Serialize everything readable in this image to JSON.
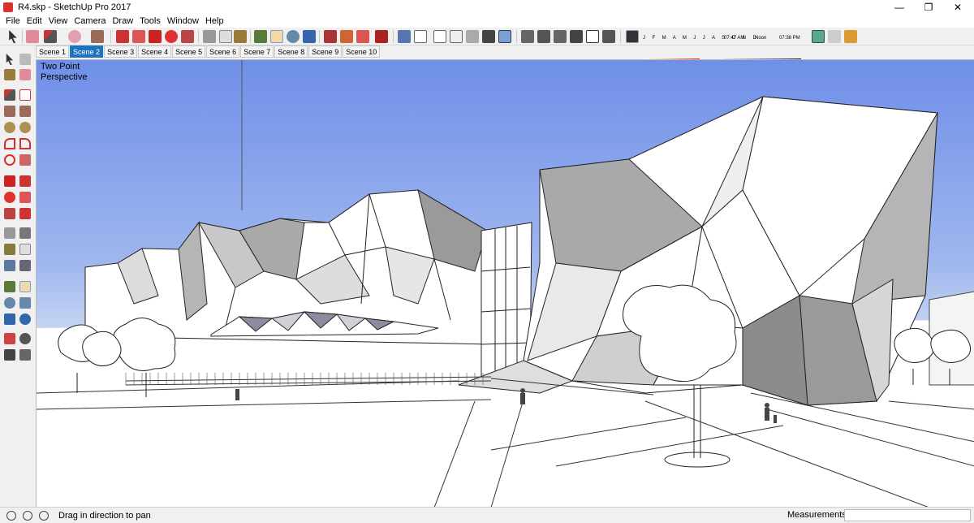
{
  "window": {
    "title": "R4.skp - SketchUp Pro 2017",
    "minimize": "—",
    "maximize": "❐",
    "close": "✕"
  },
  "menu": [
    "File",
    "Edit",
    "View",
    "Camera",
    "Draw",
    "Tools",
    "Window",
    "Help"
  ],
  "shadow_settings": {
    "months": "J F M A M J J A S O N D",
    "time_start": "07:47 AM",
    "time_mid": "Noon",
    "time_end": "07:38 PM"
  },
  "scenes": [
    "Scene 1",
    "Scene 2",
    "Scene 3",
    "Scene 4",
    "Scene 5",
    "Scene 6",
    "Scene 7",
    "Scene 8",
    "Scene 9",
    "Scene 10"
  ],
  "active_scene": "Scene 2",
  "viewport": {
    "camera_label_line1": "Two Point",
    "camera_label_line2": "Perspective"
  },
  "status": {
    "hint": "Drag in direction to pan",
    "measurements_label": "Measurements",
    "measurements_value": ""
  },
  "colors": {
    "sky_top": "#6f8fe8",
    "sky_bottom": "#dfe8f6",
    "ground": "#ffffff",
    "active_tab": "#1e73be",
    "building_light": "#ffffff",
    "building_shade": "#a9a9a9",
    "building_dark": "#8c8c8c"
  }
}
